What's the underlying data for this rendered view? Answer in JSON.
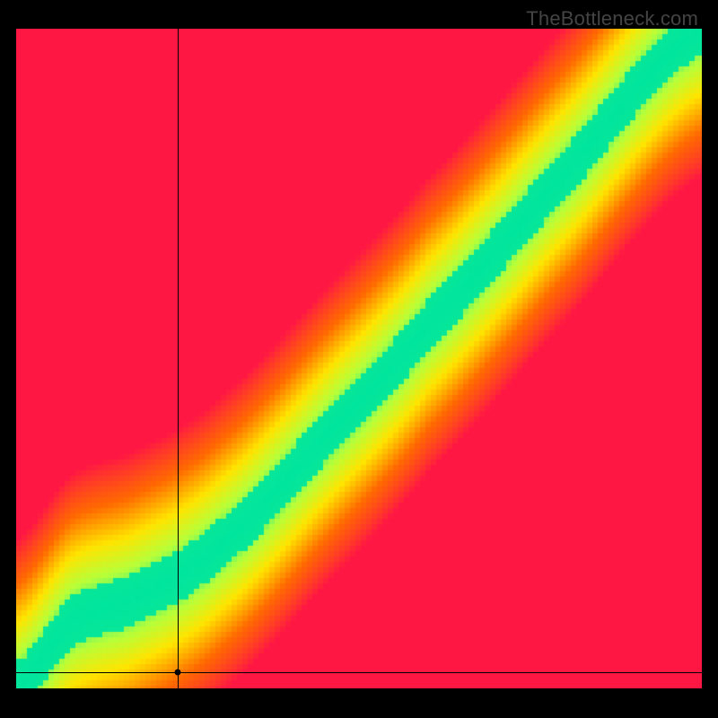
{
  "watermark": {
    "text": "TheBottleneck.com"
  },
  "chart_data": {
    "type": "heatmap",
    "title": "",
    "xlabel": "",
    "ylabel": "",
    "xlim": [
      0,
      100
    ],
    "ylim": [
      0,
      100
    ],
    "grid": false,
    "legend": false,
    "colorscale": [
      {
        "value": 0.0,
        "hex": "#ff1744"
      },
      {
        "value": 0.35,
        "hex": "#ff6a00"
      },
      {
        "value": 0.6,
        "hex": "#ffe400"
      },
      {
        "value": 0.8,
        "hex": "#b6ff3a"
      },
      {
        "value": 1.0,
        "hex": "#00e59d"
      }
    ],
    "ridge": {
      "description": "Green optimal band running from bottom-left to top-right with a slight S-curve near the origin",
      "control_points": [
        {
          "x": 0,
          "y": 0
        },
        {
          "x": 8,
          "y": 10
        },
        {
          "x": 18,
          "y": 14
        },
        {
          "x": 30,
          "y": 22
        },
        {
          "x": 45,
          "y": 38
        },
        {
          "x": 60,
          "y": 55
        },
        {
          "x": 80,
          "y": 78
        },
        {
          "x": 100,
          "y": 100
        }
      ],
      "band_width_pct": 7
    },
    "crosshair": {
      "x": 23.5,
      "y": 2.5,
      "marker": "dot"
    }
  }
}
